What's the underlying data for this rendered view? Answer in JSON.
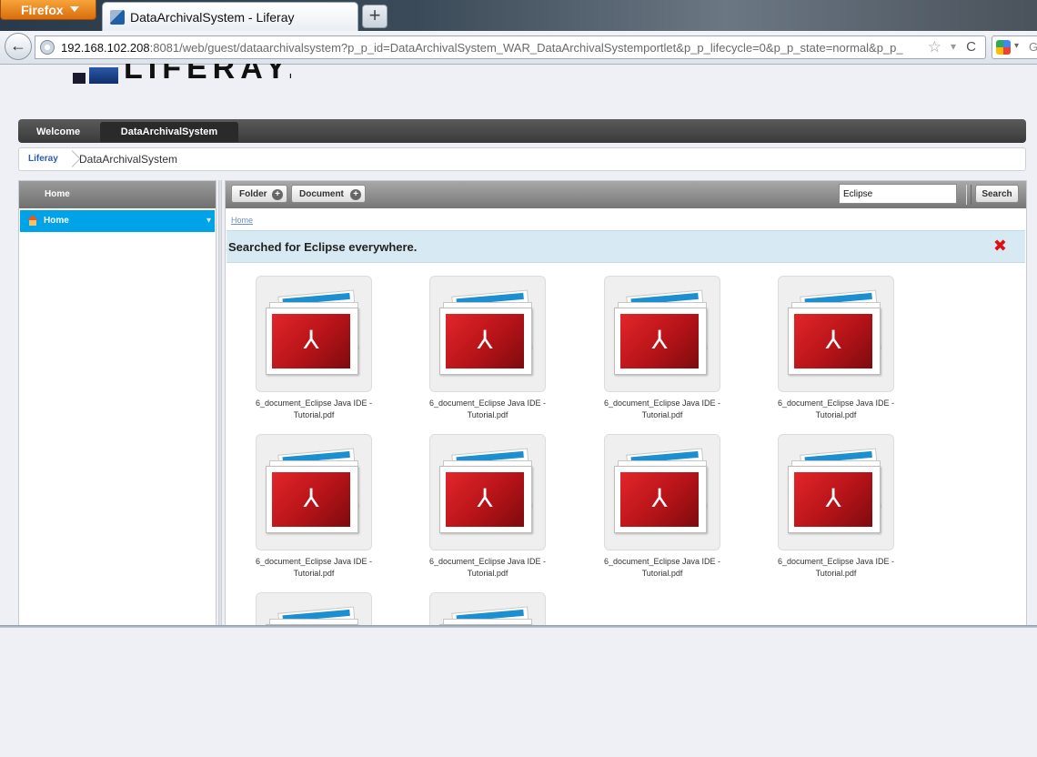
{
  "browser": {
    "menu_label": "Firefox",
    "tab_title": "DataArchivalSystem - Liferay",
    "newtab_label": "+",
    "url_host": "192.168.102.208",
    "url_rest": ":8081/web/guest/dataarchivalsystem?p_p_id=DataArchivalSystem_WAR_DataArchivalSystemportlet&p_p_lifecycle=0&p_p_state=normal&p_p_",
    "search_engine_letter": "G"
  },
  "site": {
    "logo_text": "LIFERAY.",
    "dock": {
      "welcome": "Welcome",
      "active": "DataArchivalSystem"
    },
    "breadcrumb": {
      "first": "Liferay",
      "second": "DataArchivalSystem"
    }
  },
  "left_panel": {
    "header": "Home",
    "item": "Home"
  },
  "toolbar": {
    "folder_label": "Folder",
    "document_label": "Document",
    "search_value": "Eclipse",
    "search_button": "Search"
  },
  "main": {
    "crumb": "Home",
    "alert_text": "Searched for Eclipse everywhere.",
    "alert_close": "✖"
  },
  "documents": [
    {
      "name_line1": "6_document_Eclipse Java IDE -",
      "name_line2": "Tutorial.pdf"
    },
    {
      "name_line1": "6_document_Eclipse Java IDE -",
      "name_line2": "Tutorial.pdf"
    },
    {
      "name_line1": "6_document_Eclipse Java IDE -",
      "name_line2": "Tutorial.pdf"
    },
    {
      "name_line1": "6_document_Eclipse Java IDE -",
      "name_line2": "Tutorial.pdf"
    },
    {
      "name_line1": "6_document_Eclipse Java IDE -",
      "name_line2": "Tutorial.pdf"
    },
    {
      "name_line1": "6_document_Eclipse Java IDE -",
      "name_line2": "Tutorial.pdf"
    },
    {
      "name_line1": "6_document_Eclipse Java IDE -",
      "name_line2": "Tutorial.pdf"
    },
    {
      "name_line1": "6_document_Eclipse Java IDE -",
      "name_line2": "Tutorial.pdf"
    },
    {
      "name_line1": "",
      "name_line2": ""
    },
    {
      "name_line1": "",
      "name_line2": ""
    }
  ],
  "icons": {
    "pdf_glyph": "⅄",
    "back_glyph": "←",
    "star_glyph": "☆",
    "reload_glyph": "C",
    "plus_glyph": "+",
    "drop_glyph": "▾"
  }
}
